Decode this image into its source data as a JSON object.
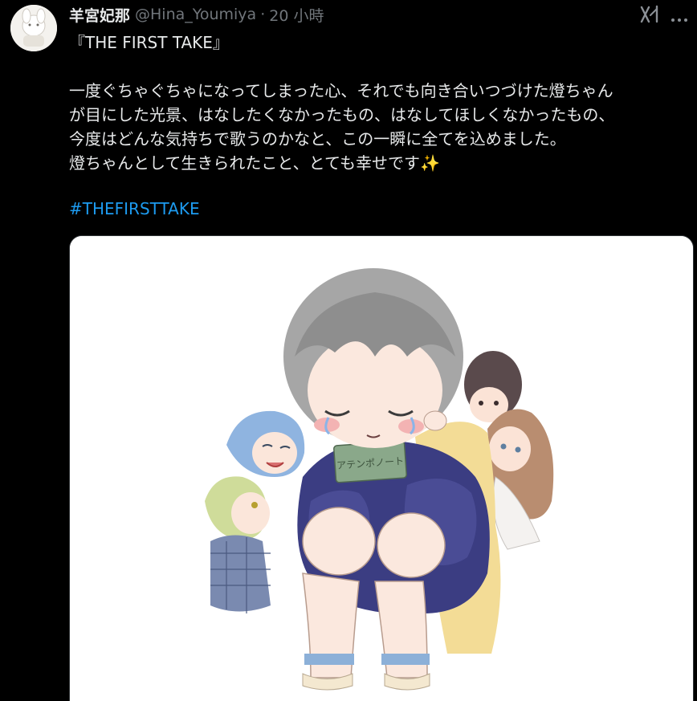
{
  "tweet": {
    "display_name": "羊宮妃那",
    "handle": "@Hina_Youmiya",
    "separator": "·",
    "time": "20 小時",
    "lines": [
      "『THE FIRST TAKE』",
      "",
      "一度ぐちゃぐちゃになってしまった心、それでも向き合いつづけた燈ちゃん",
      "が目にした光景、はなしたくなかったもの、はなしてほしくなかったもの、",
      "今度はどんな気持ちで歌うのかなと、この一瞬に全てを込めました。",
      "燈ちゃんとして生きられたこと、とても幸せです✨"
    ],
    "hashtag": "#THEFIRSTTAKE",
    "image_inner_text": "アテンポノート"
  },
  "icons": {
    "grok": "grok-icon",
    "more": "more-options-icon"
  },
  "colors": {
    "background": "#000000",
    "text_primary": "#e7e9ea",
    "text_secondary": "#71767b",
    "link": "#1d9bf0"
  }
}
